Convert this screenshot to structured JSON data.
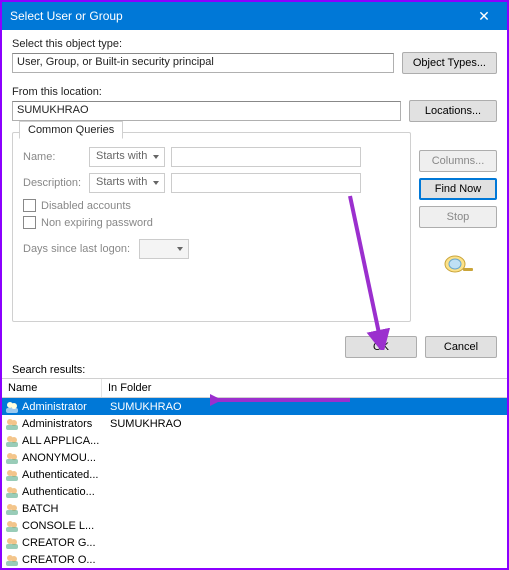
{
  "window": {
    "title": "Select User or Group"
  },
  "object_type": {
    "label": "Select this object type:",
    "value": "User, Group, or Built-in security principal",
    "button": "Object Types..."
  },
  "location": {
    "label": "From this location:",
    "value": "SUMUKHRAO",
    "button": "Locations..."
  },
  "queries": {
    "tab": "Common Queries",
    "name_label": "Name:",
    "name_mode": "Starts with",
    "desc_label": "Description:",
    "desc_mode": "Starts with",
    "disabled_accounts": "Disabled accounts",
    "non_expiring": "Non expiring password",
    "days_label": "Days since last logon:"
  },
  "side": {
    "columns": "Columns...",
    "find_now": "Find Now",
    "stop": "Stop"
  },
  "actions": {
    "ok": "OK",
    "cancel": "Cancel"
  },
  "results": {
    "label": "Search results:",
    "col_name": "Name",
    "col_folder": "In Folder",
    "rows": [
      {
        "name": "Administrator",
        "folder": "SUMUKHRAO",
        "selected": true
      },
      {
        "name": "Administrators",
        "folder": "SUMUKHRAO",
        "selected": false
      },
      {
        "name": "ALL APPLICA...",
        "folder": "",
        "selected": false
      },
      {
        "name": "ANONYMOU...",
        "folder": "",
        "selected": false
      },
      {
        "name": "Authenticated...",
        "folder": "",
        "selected": false
      },
      {
        "name": "Authenticatio...",
        "folder": "",
        "selected": false
      },
      {
        "name": "BATCH",
        "folder": "",
        "selected": false
      },
      {
        "name": "CONSOLE L...",
        "folder": "",
        "selected": false
      },
      {
        "name": "CREATOR G...",
        "folder": "",
        "selected": false
      },
      {
        "name": "CREATOR O...",
        "folder": "",
        "selected": false
      }
    ]
  },
  "colors": {
    "accent": "#0078d7",
    "border": "#8b00ff",
    "arrow": "#9b2fce"
  }
}
